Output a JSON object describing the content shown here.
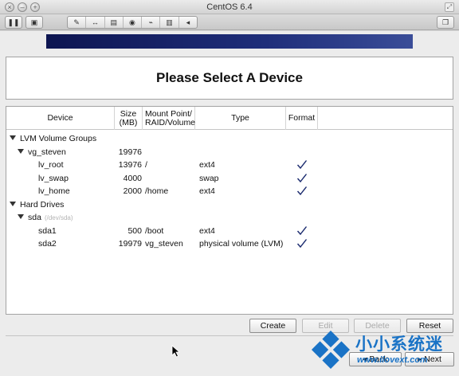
{
  "window": {
    "title": "CentOS 6.4"
  },
  "page": {
    "heading": "Please Select A Device"
  },
  "columns": {
    "device": "Device",
    "size_line1": "Size",
    "size_line2": "(MB)",
    "mount_line1": "Mount Point/",
    "mount_line2": "RAID/Volume",
    "type": "Type",
    "format": "Format"
  },
  "rows": [
    {
      "device": "LVM Volume Groups",
      "size": "",
      "mount": "",
      "type": "",
      "format": false,
      "level": 0,
      "expander": true,
      "hint": ""
    },
    {
      "device": "vg_steven",
      "size": "19976",
      "mount": "",
      "type": "",
      "format": false,
      "level": 1,
      "expander": true,
      "hint": ""
    },
    {
      "device": "lv_root",
      "size": "13976",
      "mount": "/",
      "type": "ext4",
      "format": true,
      "level": 2,
      "expander": false,
      "hint": ""
    },
    {
      "device": "lv_swap",
      "size": "4000",
      "mount": "",
      "type": "swap",
      "format": true,
      "level": 2,
      "expander": false,
      "hint": ""
    },
    {
      "device": "lv_home",
      "size": "2000",
      "mount": "/home",
      "type": "ext4",
      "format": true,
      "level": 2,
      "expander": false,
      "hint": ""
    },
    {
      "device": "Hard Drives",
      "size": "",
      "mount": "",
      "type": "",
      "format": false,
      "level": 0,
      "expander": true,
      "hint": ""
    },
    {
      "device": "sda",
      "size": "",
      "mount": "",
      "type": "",
      "format": false,
      "level": 1,
      "expander": true,
      "hint": "(/dev/sda)"
    },
    {
      "device": "sda1",
      "size": "500",
      "mount": "/boot",
      "type": "ext4",
      "format": true,
      "level": 2,
      "expander": false,
      "hint": ""
    },
    {
      "device": "sda2",
      "size": "19979",
      "mount": "vg_steven",
      "type": "physical volume (LVM)",
      "format": true,
      "level": 2,
      "expander": false,
      "hint": ""
    }
  ],
  "buttons": {
    "create": "Create",
    "edit": "Edit",
    "delete": "Delete",
    "reset": "Reset",
    "back": "Back",
    "next": "Next"
  },
  "watermark": {
    "cn": "小小系统迷",
    "url": "www.ilovext.com"
  },
  "colors": {
    "banner": "#1f2e7a",
    "check": "#1a2a6e",
    "watermark": "#1a73c6"
  }
}
